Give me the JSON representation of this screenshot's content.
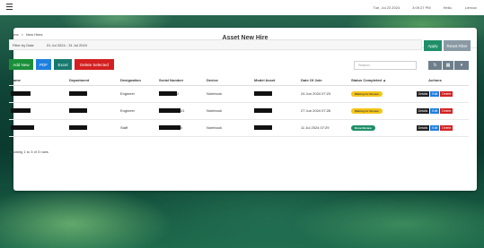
{
  "topbar": {
    "date": "Tue, Jul 23 2024",
    "time": "3:09:27 PM",
    "greeting": "Hello,",
    "user": "Lennox"
  },
  "page": {
    "title": "Asset New Hire",
    "breadcrumb": [
      "Home",
      ">",
      "New Hires"
    ]
  },
  "filter": {
    "label": "Filter by Date",
    "value": "01 Jul 2024 - 31 Jul 2024",
    "apply_label": "Apply",
    "reset_label": "Reset Filter"
  },
  "toolbar": {
    "add_label": "Add New",
    "pdf_label": "PDF",
    "excel_label": "Excel",
    "delete_label": "Delete Selected"
  },
  "search": {
    "placeholder": "Search"
  },
  "table": {
    "headers": [
      "Name",
      "Department",
      "Designation",
      "Serial Number",
      "Device",
      "Model Asset",
      "Date Of Join",
      "Status Completed",
      "Actions"
    ],
    "rows": [
      {
        "designation": "Engineer",
        "serial_suffix": "2",
        "device": "Notebook",
        "date": "24 Jun 2024 07:23",
        "status": "Waiting for Review",
        "status_type": "await"
      },
      {
        "designation": "Engineer",
        "serial_suffix": "41",
        "device": "Notebook",
        "date": "27 Jun 2024 07:26",
        "status": "Waiting for Review",
        "status_type": "await"
      },
      {
        "designation": "Staff",
        "serial_suffix": "0",
        "device": "Notebook",
        "date": "11 Jul 2024 07:29",
        "status": "Done Review",
        "status_type": "done"
      }
    ],
    "action_labels": {
      "details": "Details",
      "edit": "Edit",
      "delete": "Delete"
    }
  },
  "footer": {
    "showing": "Showing 1 to 3 of 3 rows"
  },
  "colors": {
    "primary_green": "#1e8f68",
    "danger": "#d42020",
    "info": "#1e7fe0",
    "warning": "#f5c518"
  }
}
